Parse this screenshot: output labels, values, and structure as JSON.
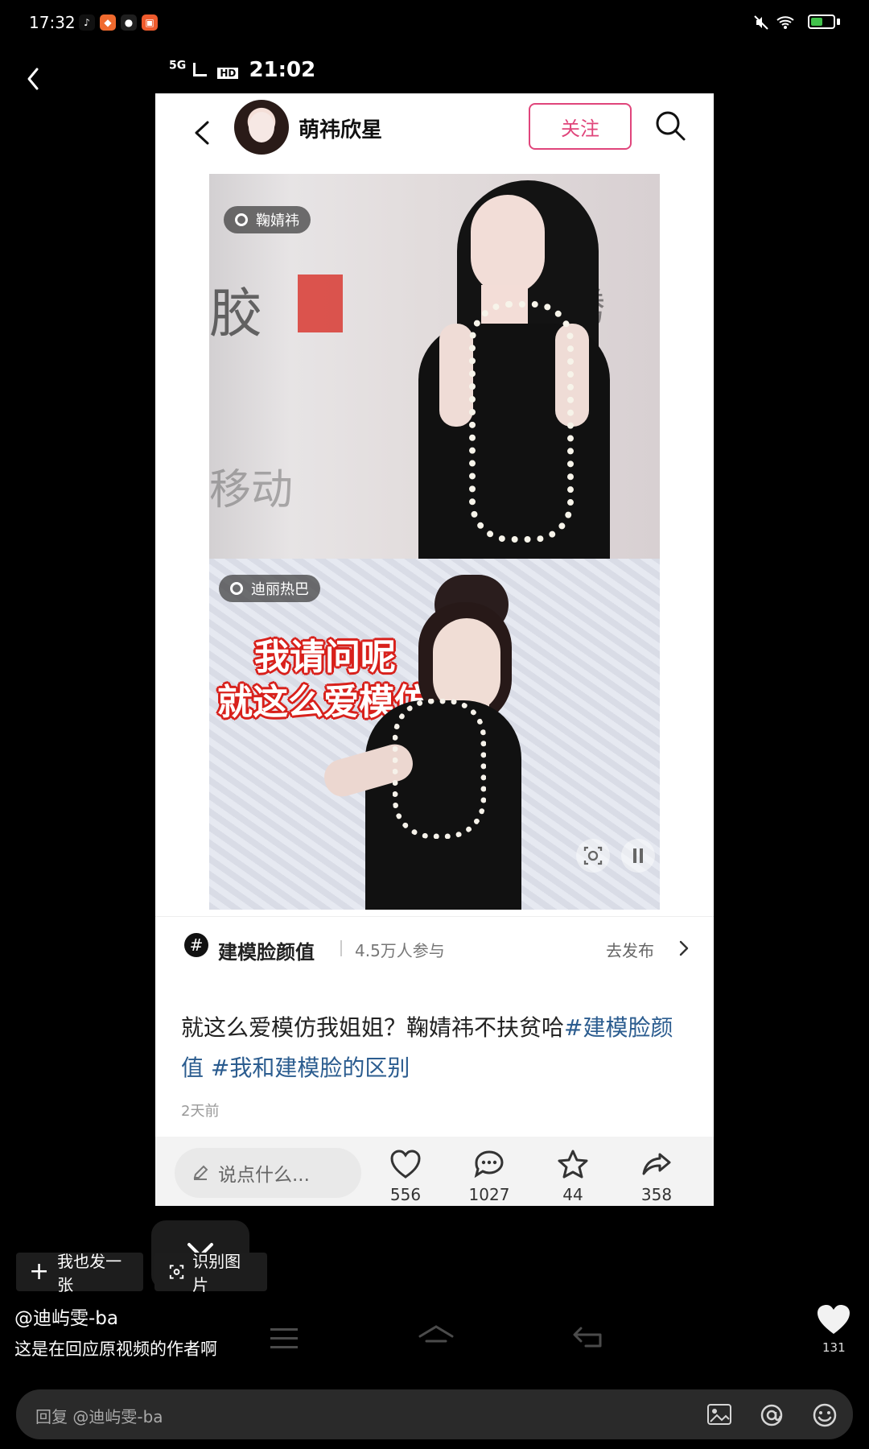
{
  "outer_status": {
    "time": "17:32",
    "app_icons": [
      "tiktok-icon",
      "orange-app-icon",
      "wechat-icon",
      "orange-grid-app-icon"
    ]
  },
  "inner_status": {
    "network_label": "5G",
    "hd_label": "HD",
    "time": "21:02"
  },
  "inner_post": {
    "author_name": "萌祎欣星",
    "follow_label": "关注",
    "top_tag": "鞠婧祎",
    "bottom_tag": "迪丽热巴",
    "overlay_line1": "我请问呢",
    "overlay_line2": "就这么爱模仿",
    "topic_title": "建模脸颜值",
    "topic_count": "4.5万人参与",
    "topic_action": "去发布",
    "caption_plain": "就这么爱模仿我姐姐？鞠婧祎不扶贫哈",
    "caption_tag1": "#建模脸颜值",
    "caption_tag2": "#我和建模脸的区别",
    "time_ago": "2天前",
    "comment_placeholder": "说点什么...",
    "stats": {
      "likes": "556",
      "comments": "1027",
      "favorites": "44",
      "shares": "358"
    }
  },
  "controls": {
    "post_too_label": "我也发一张",
    "recognize_label": "识别图片"
  },
  "reply": {
    "author": "@迪屿雯-ba",
    "text": "这是在回应原视频的作者啊",
    "like_count": "131",
    "placeholder": "回复 @迪屿雯-ba"
  },
  "colors": {
    "follow_pink": "#e0457b",
    "hashtag_blue": "#2b5c8f",
    "overlay_red": "#d8201b"
  }
}
